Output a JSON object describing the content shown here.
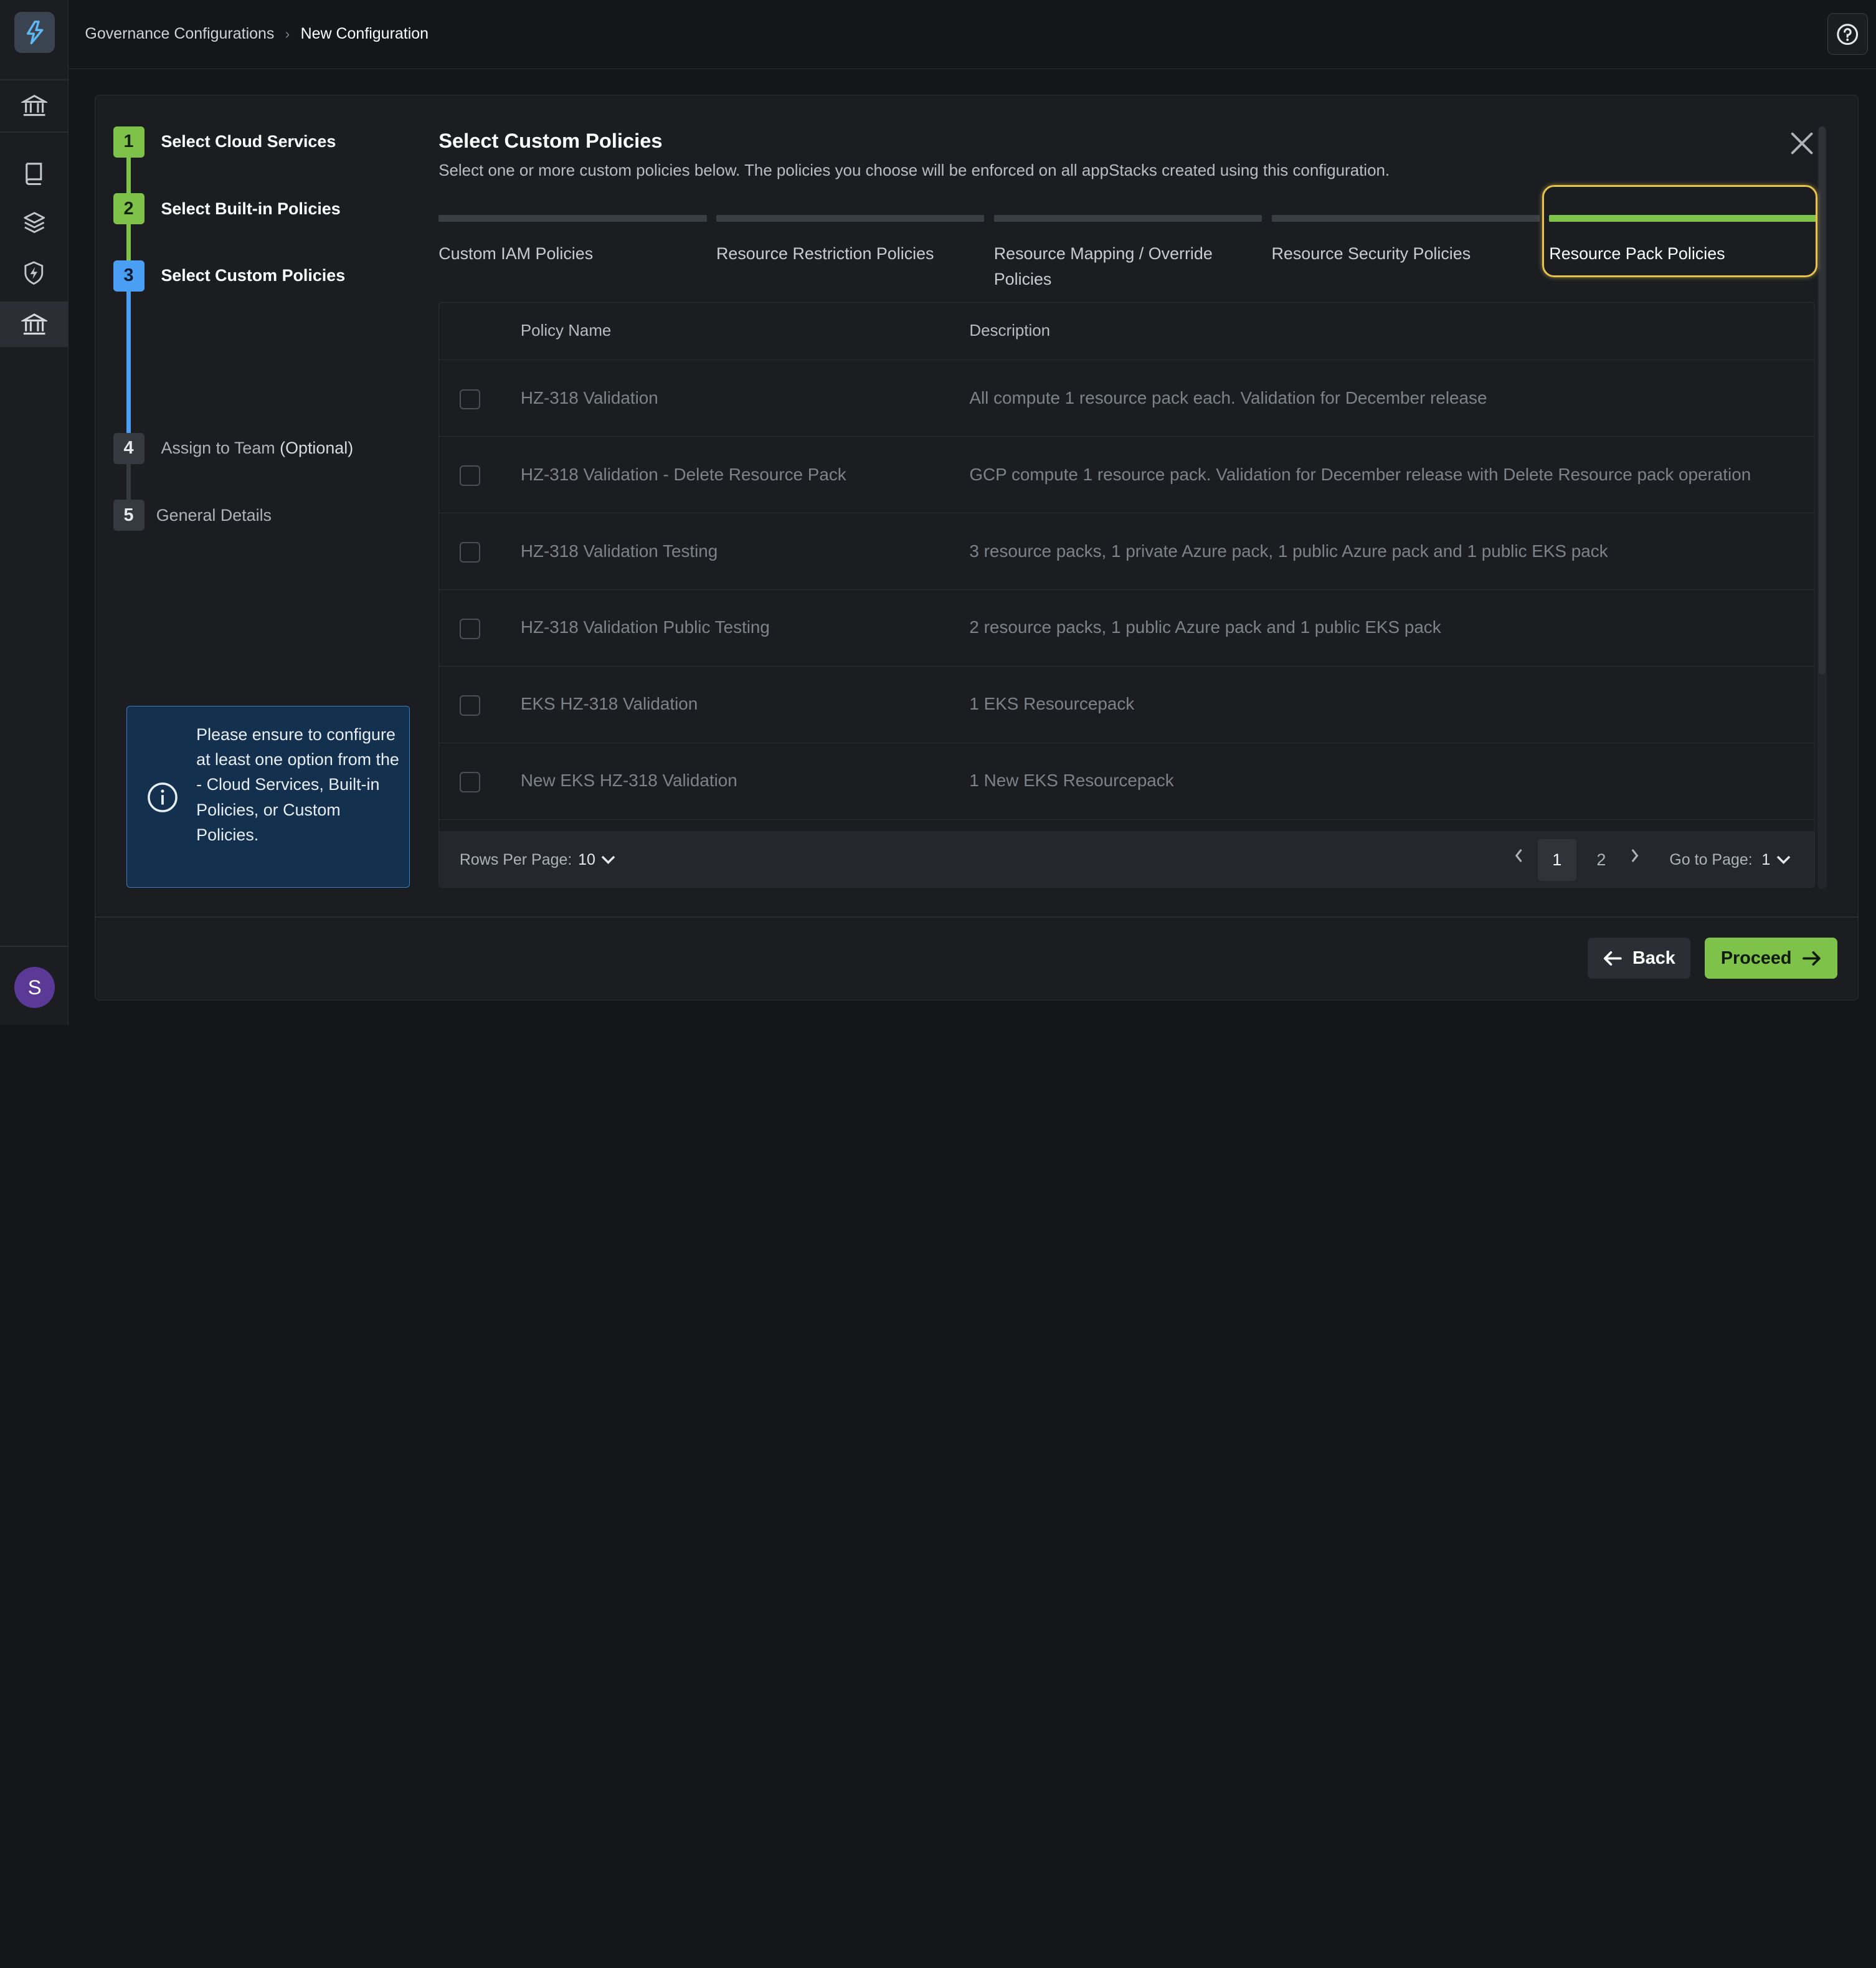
{
  "breadcrumb": {
    "parent": "Governance Configurations",
    "separator": "›",
    "current": "New Configuration"
  },
  "user": {
    "initial": "S"
  },
  "stepper": {
    "steps": [
      {
        "number": "1",
        "label": "Select Cloud Services",
        "state": "done"
      },
      {
        "number": "2",
        "label": "Select Built-in Policies",
        "state": "done"
      },
      {
        "number": "3",
        "label": "Select Custom Policies",
        "state": "current"
      },
      {
        "number": "4",
        "label": "Assign to Team",
        "optional": "(Optional)",
        "state": "todo"
      },
      {
        "number": "5",
        "label": "General Details",
        "state": "todo"
      }
    ]
  },
  "info_box": {
    "text": "Please ensure to configure at least one option from the - Cloud Services, Built-in Policies, or Custom Policies."
  },
  "content": {
    "title": "Select Custom Policies",
    "subtitle": "Select one or more custom policies below. The policies you choose will be enforced on all appStacks created using this configuration."
  },
  "tabs": [
    {
      "label": "Custom IAM Policies",
      "active": false
    },
    {
      "label": "Resource Restriction Policies",
      "active": false
    },
    {
      "label": "Resource Mapping / Override Policies",
      "active": false
    },
    {
      "label": "Resource Security Policies",
      "active": false
    },
    {
      "label": "Resource Pack Policies",
      "active": true
    }
  ],
  "table": {
    "columns": {
      "name": "Policy Name",
      "description": "Description"
    },
    "rows": [
      {
        "name": "HZ-318 Validation",
        "description": "All compute 1 resource pack each. Validation for December release",
        "checked": false
      },
      {
        "name": "HZ-318 Validation - Delete Resource Pack",
        "description": "GCP compute 1 resource pack. Validation for December release with Delete Resource pack operation",
        "checked": false
      },
      {
        "name": "HZ-318 Validation Testing",
        "description": "3 resource packs, 1 private Azure pack, 1 public Azure pack and 1 public EKS pack",
        "checked": false
      },
      {
        "name": "HZ-318 Validation Public Testing",
        "description": "2 resource packs, 1 public Azure pack and 1 public EKS pack",
        "checked": false
      },
      {
        "name": "EKS HZ-318 Validation",
        "description": "1 EKS Resourcepack",
        "checked": false
      },
      {
        "name": "New EKS HZ-318 Validation",
        "description": "1 New EKS Resourcepack",
        "checked": false
      }
    ],
    "footer": {
      "rows_per_page_label": "Rows Per Page:",
      "rows_per_page_value": "10",
      "pages": [
        "1",
        "2"
      ],
      "current_page": "1",
      "go_to_page_label": "Go to Page:",
      "go_to_page_value": "1"
    }
  },
  "actions": {
    "back": "Back",
    "proceed": "Proceed"
  },
  "colors": {
    "accent_green": "#7ec24a",
    "current_blue": "#4a9ff5",
    "focus_yellow": "#e7c24d",
    "info_bg": "#13304e"
  },
  "icons": [
    "logo-icon",
    "bank-icon",
    "book-icon",
    "layers-icon",
    "shield-bolt-icon",
    "help-icon",
    "close-icon",
    "info-icon",
    "chevron-down-icon",
    "chevron-left-icon",
    "chevron-right-icon",
    "arrow-left-icon",
    "arrow-right-icon"
  ]
}
